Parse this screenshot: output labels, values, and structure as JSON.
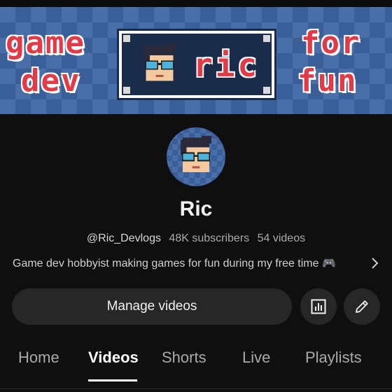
{
  "banner": {
    "left_top": "game",
    "left_bottom": "dev",
    "center_name": "ric",
    "right_top": "for",
    "right_bottom": "fun"
  },
  "channel": {
    "name": "Ric",
    "handle": "@Ric_Devlogs",
    "subscribers": "48K subscribers",
    "videos": "54 videos",
    "description": "Game dev hobbyist making games for fun during my free time 🎮"
  },
  "actions": {
    "manage_label": "Manage videos",
    "stats_icon": "analytics-icon",
    "edit_icon": "pencil-icon"
  },
  "tabs": [
    {
      "label": "Home",
      "active": false
    },
    {
      "label": "Videos",
      "active": true
    },
    {
      "label": "Shorts",
      "active": false
    },
    {
      "label": "Live",
      "active": false
    },
    {
      "label": "Playlists",
      "active": false
    }
  ],
  "colors": {
    "background": "#0f0f0f",
    "button_bg": "#272727",
    "banner_blue": "#4a6fa8",
    "banner_text_red": "#e23b47"
  }
}
